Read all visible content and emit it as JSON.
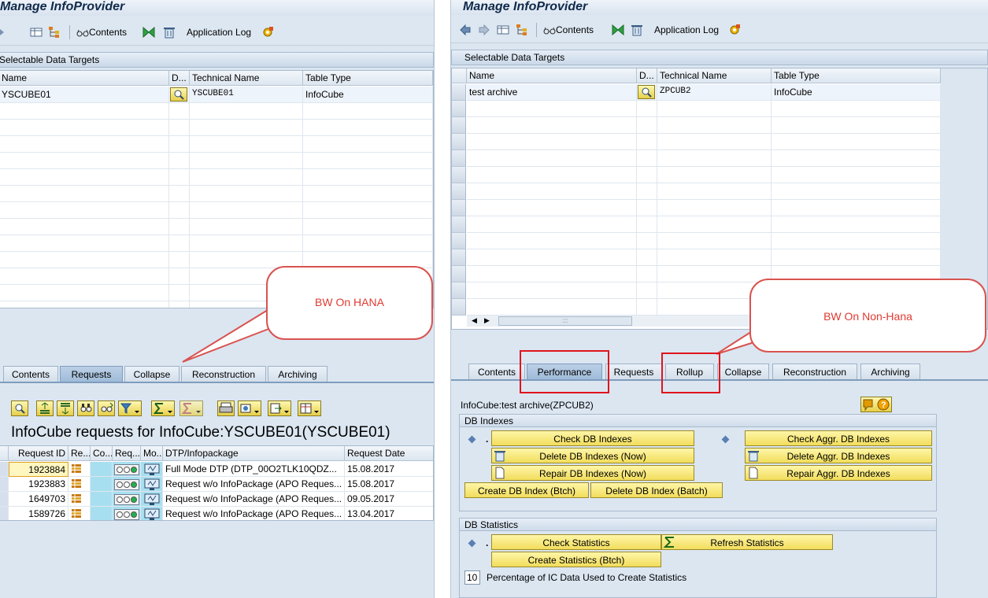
{
  "left": {
    "title": "Manage InfoProvider",
    "toolbar": {
      "contents": "Contents",
      "application_log": "Application Log"
    },
    "section_title": "Selectable Data Targets",
    "grid_headers": [
      "Name",
      "D...",
      "Technical Name",
      "Table Type"
    ],
    "grid_row": {
      "name": "YSCUBE01",
      "technical_name": "YSCUBE01",
      "table_type": "InfoCube"
    },
    "tabs": [
      "Contents",
      "Requests",
      "Collapse",
      "Reconstruction",
      "Archiving"
    ],
    "active_tab": "Requests",
    "requests_title": "InfoCube requests for InfoCube:YSCUBE01(YSCUBE01)",
    "req_headers": [
      "Request ID",
      "Re...",
      "Co...",
      "Req...",
      "Mo...",
      "DTP/Infopackage",
      "Request Date"
    ],
    "req_rows": [
      {
        "id": "1923884",
        "dtp": "Full Mode DTP    (DTP_00O2TLK10QDZ...",
        "date": "15.08.2017"
      },
      {
        "id": "1923883",
        "dtp": "Request w/o InfoPackage (APO Reques...",
        "date": "15.08.2017"
      },
      {
        "id": "1649703",
        "dtp": "Request w/o InfoPackage (APO Reques...",
        "date": "09.05.2017"
      },
      {
        "id": "1589726",
        "dtp": "Request w/o InfoPackage (APO Reques...",
        "date": "13.04.2017"
      }
    ]
  },
  "right": {
    "title": "Manage InfoProvider",
    "toolbar": {
      "contents": "Contents",
      "application_log": "Application Log"
    },
    "section_title": "Selectable Data Targets",
    "grid_headers": [
      "Name",
      "D...",
      "Technical Name",
      "Table Type"
    ],
    "grid_row": {
      "name": "test archive",
      "technical_name": "ZPCUB2",
      "table_type": "InfoCube"
    },
    "tabs": [
      "Contents",
      "Performance",
      "Requests",
      "Rollup",
      "Collapse",
      "Reconstruction",
      "Archiving"
    ],
    "active_tab": "Performance",
    "infocube_label": "InfoCube:test archive(ZPCUB2)",
    "db_indexes": {
      "title": "DB Indexes",
      "check": "Check DB Indexes",
      "delete_now": "Delete DB Indexes (Now)",
      "repair_now": "Repair DB Indexes (Now)",
      "create_batch": "Create DB Index (Btch)",
      "delete_batch": "Delete DB Index (Batch)",
      "check_aggr": "Check Aggr. DB Indexes",
      "delete_aggr": "Delete Aggr. DB Indexes",
      "repair_aggr": "Repair Aggr. DB Indexes"
    },
    "db_statistics": {
      "title": "DB Statistics",
      "check": "Check Statistics",
      "refresh": "Refresh Statistics",
      "create_batch": "Create Statistics (Btch)",
      "percentage_value": "10",
      "percentage_label": "Percentage of IC Data Used to Create Statistics"
    }
  },
  "annotations": {
    "left_callout": "BW On HANA",
    "right_callout": "BW On Non-Hana",
    "accent_red": "#e0141c"
  }
}
